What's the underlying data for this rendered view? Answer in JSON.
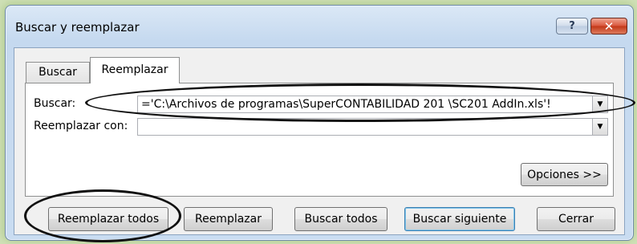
{
  "window": {
    "title": "Buscar y reemplazar",
    "help_glyph": "?",
    "close_glyph": "✕"
  },
  "tabs": {
    "find_label": "Buscar",
    "replace_label": "Reemplazar",
    "active": "Reemplazar"
  },
  "find_field": {
    "label": "Buscar:",
    "value": "='C:\\Archivos de programas\\SuperCONTABILIDAD 201   \\SC201   AddIn.xls'!"
  },
  "replace_field": {
    "label": "Reemplazar con:",
    "value": ""
  },
  "buttons": {
    "options": "Opciones >>",
    "replace_all": "Reemplazar todos",
    "replace": "Reemplazar",
    "find_all": "Buscar todos",
    "find_next": "Buscar siguiente",
    "close": "Cerrar"
  },
  "icons": {
    "dropdown": "▼"
  },
  "colors": {
    "background_glow": "#cfe0b6",
    "title_gradient_top": "#dbe8f6",
    "close_button_red": "#c23717",
    "default_button_border": "#3c7fb1",
    "annotation_ellipse": "#111111"
  }
}
